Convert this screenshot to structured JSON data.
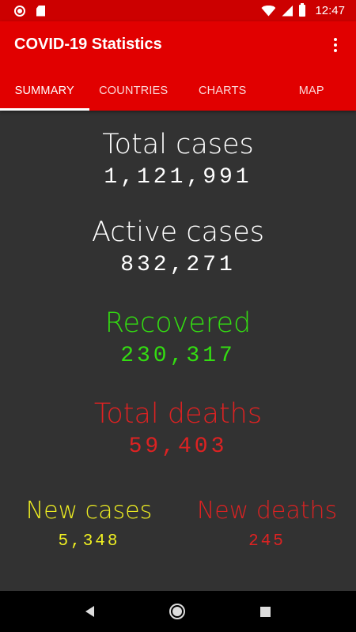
{
  "status_bar": {
    "time": "12:47",
    "icons": [
      "record-icon",
      "sd-card-icon",
      "wifi-icon",
      "signal-icon",
      "battery-icon"
    ]
  },
  "app_bar": {
    "title": "COVID-19 Statistics",
    "menu_icon": "overflow-menu-icon",
    "tabs": [
      {
        "label": "SUMMARY",
        "active": true
      },
      {
        "label": "COUNTRIES",
        "active": false
      },
      {
        "label": "CHARTS",
        "active": false
      },
      {
        "label": "MAP",
        "active": false
      }
    ]
  },
  "summary": {
    "total_cases": {
      "label": "Total cases",
      "value": "1,121,991"
    },
    "active_cases": {
      "label": "Active cases",
      "value": "832,271"
    },
    "recovered": {
      "label": "Recovered",
      "value": "230,317"
    },
    "total_deaths": {
      "label": "Total deaths",
      "value": "59,403"
    },
    "new_cases": {
      "label": "New cases",
      "value": "5,348"
    },
    "new_deaths": {
      "label": "New deaths",
      "value": "245"
    }
  },
  "colors": {
    "app_bar": "#e10000",
    "status_bar": "#cc0000",
    "background": "#323232",
    "neutral": "#ffffff",
    "recovered": "#33dd11",
    "deaths": "#dd2222",
    "new_cases": "#eeee22"
  },
  "nav_bar": {
    "icons": [
      "back-icon",
      "home-icon",
      "recents-icon"
    ]
  }
}
